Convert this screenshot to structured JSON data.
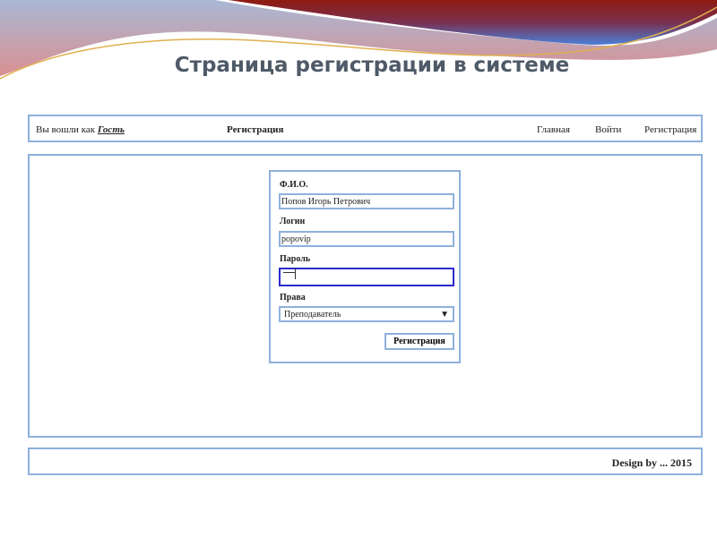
{
  "slide_title": "Страница регистрации в системе",
  "topbar": {
    "logged_in_prefix": "Вы вошли как",
    "user": "Гость",
    "page_title": "Регистрация",
    "nav": [
      "Главная",
      "Войти",
      "Регистрация"
    ]
  },
  "form": {
    "fio_label": "Ф.И.О.",
    "fio_value": "Попов Игорь Петрович",
    "login_label": "Логин",
    "login_value": "popovip",
    "password_label": "Пароль",
    "password_value": "",
    "role_label": "Права",
    "role_value": "Преподаватель",
    "role_arrow": "▼",
    "submit_label": "Регистрация"
  },
  "footer": {
    "text": "Design by ... 2015"
  },
  "colors": {
    "border": "#8fb0dc",
    "focus": "#2a2ad0",
    "title": "#4f5a68"
  }
}
